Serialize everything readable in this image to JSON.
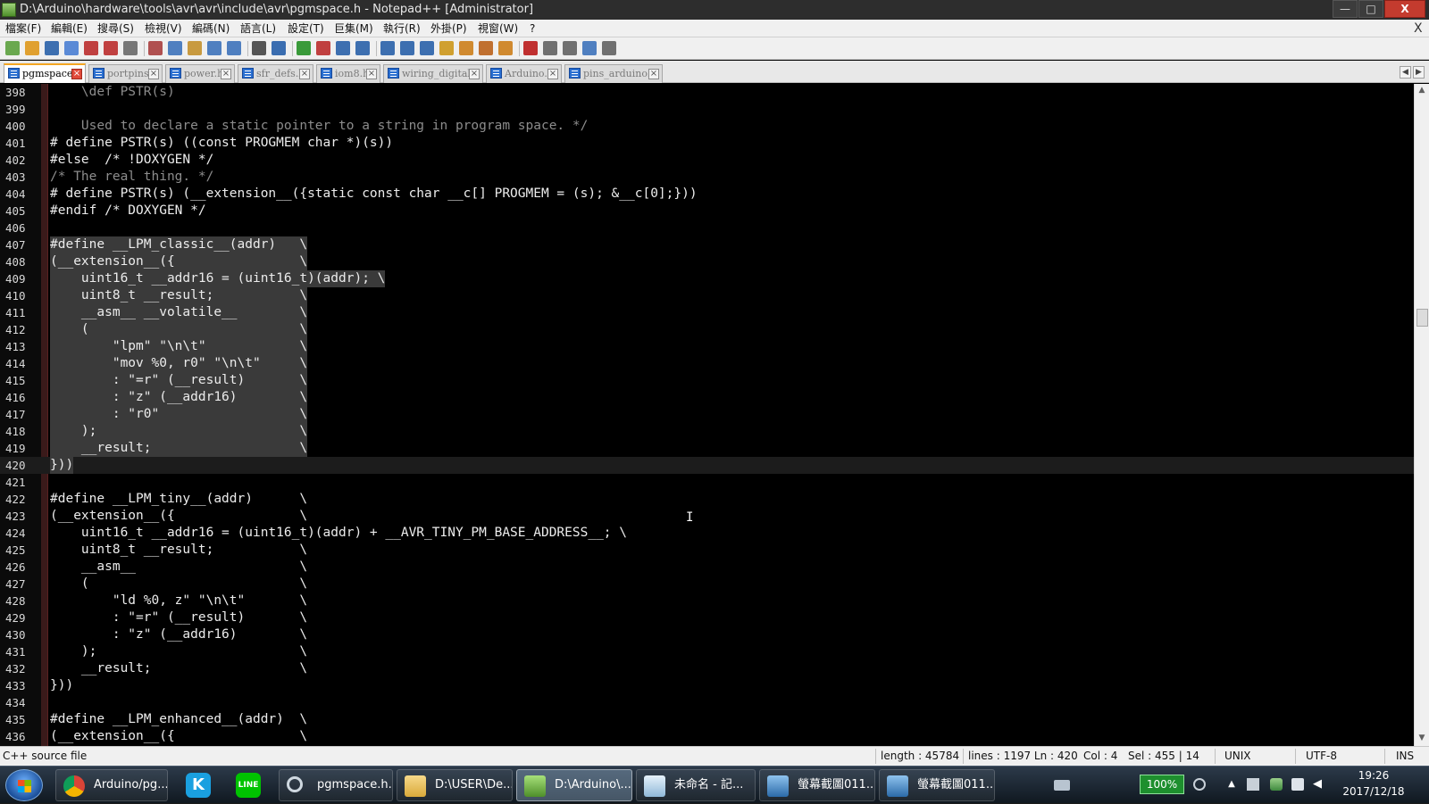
{
  "window": {
    "title": "D:\\Arduino\\hardware\\tools\\avr\\avr\\include\\avr\\pgmspace.h - Notepad++ [Administrator]",
    "minimize": "—",
    "maximize": "□",
    "close": "X"
  },
  "menu": [
    "檔案(F)",
    "編輯(E)",
    "搜尋(S)",
    "檢視(V)",
    "編碼(N)",
    "語言(L)",
    "設定(T)",
    "巨集(M)",
    "執行(R)",
    "外掛(P)",
    "視窗(W)",
    "?"
  ],
  "menu_close": "X",
  "toolbar_icons": [
    "new-file-icon",
    "open-file-icon",
    "save-icon",
    "save-all-icon",
    "close-icon",
    "close-all-icon",
    "print-icon",
    "cut-icon",
    "copy-icon",
    "paste-icon",
    "undo-icon",
    "redo-icon",
    "find-icon",
    "replace-icon",
    "zoom-in-icon",
    "zoom-out-icon",
    "sync-vertical-icon",
    "sync-horizontal-icon",
    "word-wrap-icon",
    "show-all-chars-icon",
    "indent-guide-icon",
    "folder-as-workspace-icon",
    "doc-map-icon",
    "function-list-icon",
    "monitoring-icon",
    "record-macro-icon",
    "stop-record-icon",
    "play-macro-icon",
    "play-multiple-icon",
    "save-macro-icon"
  ],
  "tabs": [
    {
      "label": "pgmspace.h",
      "active": true
    },
    {
      "label": "portpins.h",
      "active": false
    },
    {
      "label": "power.h",
      "active": false
    },
    {
      "label": "sfr_defs.h",
      "active": false
    },
    {
      "label": "iom8.h",
      "active": false
    },
    {
      "label": "wiring_digital.c",
      "active": false
    },
    {
      "label": "Arduino.h",
      "active": false
    },
    {
      "label": "pins_arduino.h",
      "active": false
    }
  ],
  "editor": {
    "current_line": 420,
    "lines": [
      {
        "n": "398",
        "text": "    \\def PSTR(s)",
        "style": "comment"
      },
      {
        "n": "399",
        "text": "",
        "style": "comment"
      },
      {
        "n": "400",
        "text": "    Used to declare a static pointer to a string in program space. */",
        "style": "comment"
      },
      {
        "n": "401",
        "text": "# define PSTR(s) ((const PROGMEM char *)(s))",
        "style": "code"
      },
      {
        "n": "402",
        "text": "#else  /* !DOXYGEN */",
        "style": "code"
      },
      {
        "n": "403",
        "text": "/* The real thing. */",
        "style": "comment"
      },
      {
        "n": "404",
        "text": "# define PSTR(s) (__extension__({static const char __c[] PROGMEM = (s); &__c[0];}))",
        "style": "code"
      },
      {
        "n": "405",
        "text": "#endif /* DOXYGEN */",
        "style": "code"
      },
      {
        "n": "406",
        "text": "",
        "style": "code"
      },
      {
        "n": "407",
        "text": "#define __LPM_classic__(addr)   \\",
        "style": "code",
        "selected": true
      },
      {
        "n": "408",
        "text": "(__extension__({                \\",
        "style": "code",
        "selected": true,
        "brace": true
      },
      {
        "n": "409",
        "text": "    uint16_t __addr16 = (uint16_t)(addr); \\",
        "style": "code",
        "selected": true
      },
      {
        "n": "410",
        "text": "    uint8_t __result;           \\",
        "style": "code",
        "selected": true
      },
      {
        "n": "411",
        "text": "    __asm__ __volatile__        \\",
        "style": "code",
        "selected": true
      },
      {
        "n": "412",
        "text": "    (                           \\",
        "style": "code",
        "selected": true
      },
      {
        "n": "413",
        "text": "        \"lpm\" \"\\n\\t\"            \\",
        "style": "code",
        "selected": true
      },
      {
        "n": "414",
        "text": "        \"mov %0, r0\" \"\\n\\t\"     \\",
        "style": "code",
        "selected": true
      },
      {
        "n": "415",
        "text": "        : \"=r\" (__result)       \\",
        "style": "code",
        "selected": true
      },
      {
        "n": "416",
        "text": "        : \"z\" (__addr16)        \\",
        "style": "code",
        "selected": true
      },
      {
        "n": "417",
        "text": "        : \"r0\"                  \\",
        "style": "code",
        "selected": true
      },
      {
        "n": "418",
        "text": "    );                          \\",
        "style": "code",
        "selected": true
      },
      {
        "n": "419",
        "text": "    __result;                   \\",
        "style": "code",
        "selected": true
      },
      {
        "n": "420",
        "text": "}))",
        "style": "code",
        "selected": true,
        "current": true,
        "brace": true
      },
      {
        "n": "421",
        "text": "",
        "style": "code"
      },
      {
        "n": "422",
        "text": "#define __LPM_tiny__(addr)      \\",
        "style": "code"
      },
      {
        "n": "423",
        "text": "(__extension__({                \\",
        "style": "code"
      },
      {
        "n": "424",
        "text": "    uint16_t __addr16 = (uint16_t)(addr) + __AVR_TINY_PM_BASE_ADDRESS__; \\",
        "style": "code"
      },
      {
        "n": "425",
        "text": "    uint8_t __result;           \\",
        "style": "code"
      },
      {
        "n": "426",
        "text": "    __asm__                     \\",
        "style": "code"
      },
      {
        "n": "427",
        "text": "    (                           \\",
        "style": "code"
      },
      {
        "n": "428",
        "text": "        \"ld %0, z\" \"\\n\\t\"       \\",
        "style": "code"
      },
      {
        "n": "429",
        "text": "        : \"=r\" (__result)       \\",
        "style": "code"
      },
      {
        "n": "430",
        "text": "        : \"z\" (__addr16)        \\",
        "style": "code"
      },
      {
        "n": "431",
        "text": "    );                          \\",
        "style": "code"
      },
      {
        "n": "432",
        "text": "    __result;                   \\",
        "style": "code"
      },
      {
        "n": "433",
        "text": "}))",
        "style": "code"
      },
      {
        "n": "434",
        "text": "",
        "style": "code"
      },
      {
        "n": "435",
        "text": "#define __LPM_enhanced__(addr)  \\",
        "style": "code"
      },
      {
        "n": "436",
        "text": "(__extension__({                \\",
        "style": "code"
      }
    ]
  },
  "statusbar": {
    "file_type": "C++ source file",
    "length": "length : 45784",
    "lines_pos": "lines : 1197   Ln : 420",
    "col": "Col : 4",
    "sel": "Sel : 455 | 14",
    "eol": "UNIX",
    "encoding": "UTF-8",
    "mode": "INS"
  },
  "taskbar": {
    "pins": [
      {
        "name": "kkbox-icon",
        "glyph": "K",
        "color": "#1aa0e0"
      },
      {
        "name": "line-icon",
        "glyph": "LINE",
        "color": "#00c300"
      }
    ],
    "tasks": [
      {
        "label": "Arduino/pg...",
        "icon": "chrome-icon",
        "active": false
      },
      {
        "label": "pgmspace.h...",
        "icon": "search-icon",
        "active": false
      },
      {
        "label": "D:\\USER\\De...",
        "icon": "folder-icon",
        "active": false
      },
      {
        "label": "D:\\Arduino\\...",
        "icon": "notepad-plus-plus-icon",
        "active": true
      },
      {
        "label": "未命名 - 記...",
        "icon": "notepad-icon",
        "active": false
      },
      {
        "label": "螢幕截圖011...",
        "icon": "image-icon",
        "active": false
      },
      {
        "label": "螢幕截圖011...",
        "icon": "image-icon",
        "active": false
      }
    ],
    "battery": "100%",
    "time": "19:26",
    "date": "2017/12/18"
  }
}
